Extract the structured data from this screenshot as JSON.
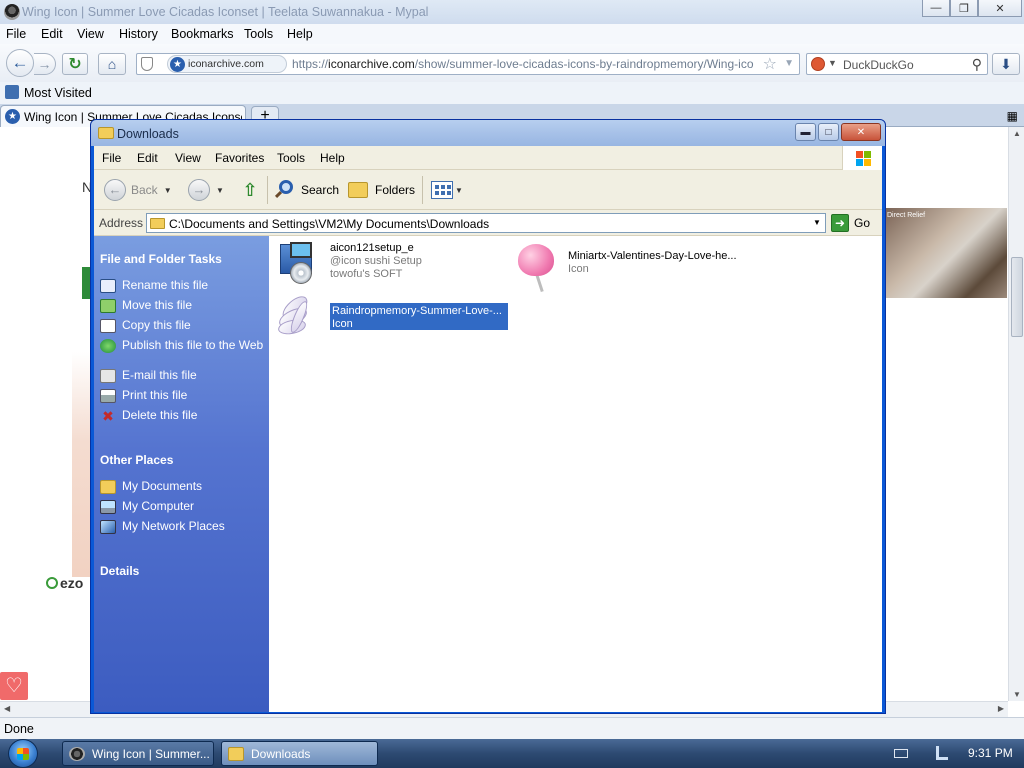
{
  "browser": {
    "window_title": "Wing Icon | Summer Love Cicadas Iconset | Teelata Suwannakua - Mypal",
    "menu": [
      "File",
      "Edit",
      "View",
      "History",
      "Bookmarks",
      "Tools",
      "Help"
    ],
    "site_name": "iconarchive.com",
    "url_prefix": "https://",
    "url_domain": "iconarchive.com",
    "url_path": "/show/summer-love-cicadas-icons-by-raindropmemory/Wing-icon.html",
    "search_placeholder": "DuckDuckGo",
    "bookmarks": [
      "Most Visited"
    ],
    "tab_title": "Wing Icon | Summer Love Cicadas Iconset",
    "status": "Done",
    "page_fragments": {
      "letter_n": "N",
      "ezo": "ezo",
      "photo_caption": "Direct Relief"
    }
  },
  "explorer": {
    "title": "Downloads",
    "menu": [
      "File",
      "Edit",
      "View",
      "Favorites",
      "Tools",
      "Help"
    ],
    "toolbar": {
      "back": "Back",
      "search": "Search",
      "folders": "Folders"
    },
    "address_label": "Address",
    "address_path": "C:\\Documents and Settings\\VM2\\My Documents\\Downloads",
    "go_label": "Go",
    "sidebar": {
      "file_tasks_title": "File and Folder Tasks",
      "file_tasks": [
        "Rename this file",
        "Move this file",
        "Copy this file",
        "Publish this file to the Web",
        "E-mail this file",
        "Print this file",
        "Delete this file"
      ],
      "other_places_title": "Other Places",
      "other_places": [
        "My Documents",
        "My Computer",
        "My Network Places"
      ],
      "details_title": "Details"
    },
    "files": [
      {
        "name": "aicon121setup_e",
        "line2": "@icon sushi Setup",
        "line3": "towofu's SOFT",
        "icon": "setup-cd-icon"
      },
      {
        "name": "Miniartx-Valentines-Day-Love-he...",
        "line2": "Icon",
        "icon": "heart-lollipop-icon"
      },
      {
        "name": "Raindropmemory-Summer-Love-...",
        "line2": "Icon",
        "icon": "wing-icon",
        "selected": true
      }
    ]
  },
  "taskbar": {
    "buttons": [
      "Wing Icon | Summer...",
      "Downloads"
    ],
    "clock": "9:31 PM"
  },
  "colors": {
    "xp_blue_border": "#0a58d6",
    "sidebar_top": "#7a9de0",
    "selection": "#316ac5"
  }
}
